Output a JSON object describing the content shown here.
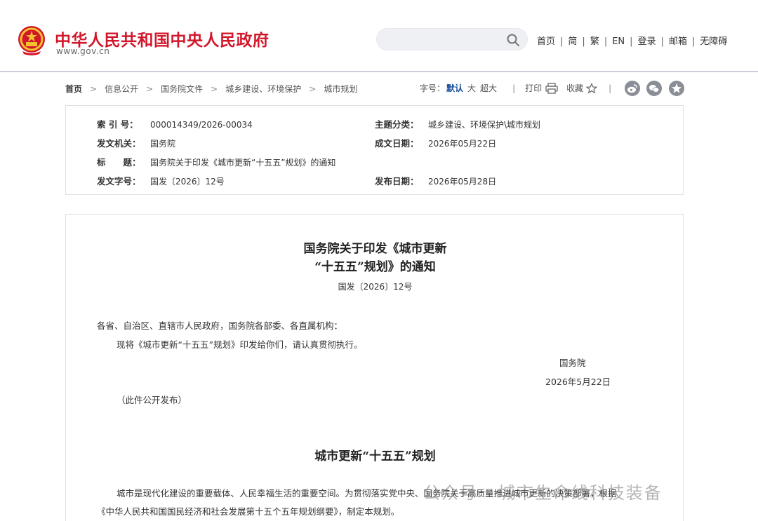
{
  "header": {
    "site_title": "中华人民共和国中央人民政府",
    "site_domain": "www.gov.cn",
    "search_placeholder": "",
    "nav": [
      "首页",
      "简",
      "繁",
      "EN",
      "登录",
      "邮箱",
      "无障碍"
    ]
  },
  "breadcrumb": [
    "首页",
    "信息公开",
    "国务院文件",
    "城乡建设、环境保护",
    "城市规划"
  ],
  "tools": {
    "font_size_label": "字号：",
    "font_default": "默认",
    "font_large": "大",
    "font_xlarge": "超大",
    "print": "打印",
    "favorite": "收藏"
  },
  "meta": {
    "index_label": "索 引 号：",
    "index_value": "000014349/2026-00034",
    "topic_label": "主题分类：",
    "topic_value": "城乡建设、环境保护\\城市规划",
    "issuer_label": "发文机关：",
    "issuer_value": "国务院",
    "date_written_label": "成文日期：",
    "date_written_value": "2026年05月22日",
    "title_label": "标　　题：",
    "title_value": "国务院关于印发《城市更新“十五五”规划》的通知",
    "doc_no_label": "发文字号：",
    "doc_no_value": "国发〔2026〕12号",
    "publish_label": "发布日期：",
    "publish_value": "2026年05月28日"
  },
  "content": {
    "title_line1": "国务院关于印发《城市更新",
    "title_line2": "“十五五”规划》的通知",
    "doc_number": "国发〔2026〕12号",
    "salutation": "各省、自治区、直辖市人民政府，国务院各部委、各直属机构：",
    "body": "现将《城市更新“十五五”规划》印发给你们，请认真贯彻执行。",
    "signer": "国务院",
    "sign_date": "2026年5月22日",
    "release_note": "（此件公开发布）",
    "plan_title": "城市更新“十五五”规划",
    "plan_para_line1": "城市是现代化建设的重要载体、人民幸福生活的重要空间。为贯彻落实党中央、国务院关于高质量推进城市更新的决策部署，根据",
    "plan_para_line2": "《中华人民共和国国民经济和社会发展第十五个五年规划纲要》，制定本规划。"
  },
  "watermark": "公众号 · 城市生命线科技装备",
  "colors": {
    "brand_red": "#d3172b",
    "link_blue": "#1a4f9c",
    "border": "#dde0e5"
  }
}
